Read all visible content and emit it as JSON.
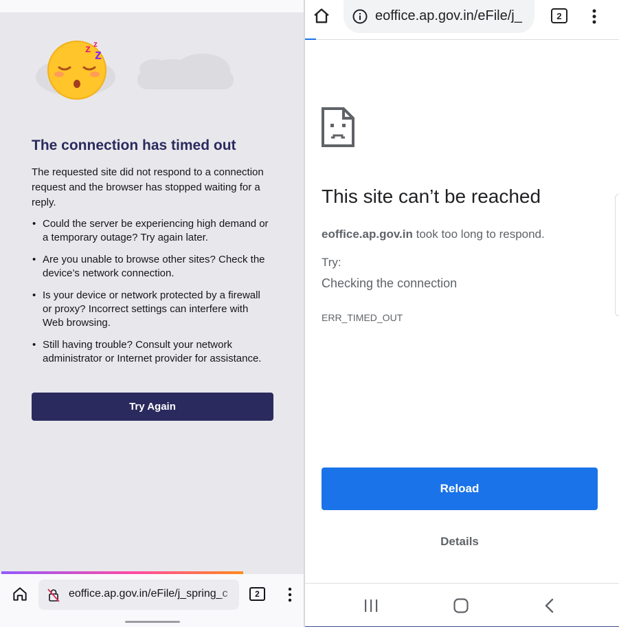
{
  "left": {
    "title": "The connection has timed out",
    "description": "The requested site did not respond to a connection request and the browser has stopped waiting for a reply.",
    "bullets": [
      "Could the server be experiencing high demand or a temporary outage? Try again later.",
      "Are you unable to browse other sites? Check the device’s network connection.",
      "Is your device or network protected by a firewall or proxy? Incorrect settings can interfere with Web browsing.",
      "Still having trouble? Consult your network administrator or Internet provider for assistance."
    ],
    "try_again_label": "Try Again",
    "toolbar": {
      "url": "eoffice.ap.gov.in/eFile/j_spring_c",
      "tab_count": "2",
      "icons": [
        "home-icon",
        "lock-off-icon",
        "tabs-icon",
        "more-vert-icon"
      ]
    },
    "colors": {
      "accent": "#2b2a5e",
      "background": "#e8e8ec"
    },
    "load_progress": 0.8
  },
  "right": {
    "toolbar": {
      "url": "eoffice.ap.gov.in/eFile/j_",
      "tab_count": "2",
      "icons": [
        "home-icon",
        "info-icon",
        "tabs-icon",
        "more-vert-icon"
      ]
    },
    "title": "This site can’t be reached",
    "domain": "eoffice.ap.gov.in",
    "message": " took too long to respond.",
    "try_label": "Try:",
    "suggestion": "Checking the connection",
    "error_code": "ERR_TIMED_OUT",
    "reload_label": "Reload",
    "details_label": "Details",
    "nav_icons": [
      "recents-icon",
      "home-icon",
      "back-icon"
    ],
    "colors": {
      "accent": "#1a73e8"
    }
  }
}
